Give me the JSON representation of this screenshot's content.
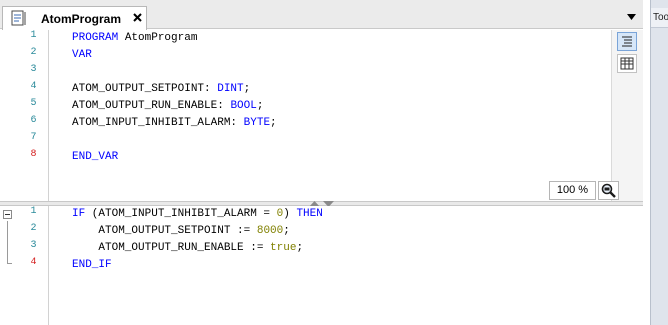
{
  "tab": {
    "label": "AtomProgram"
  },
  "right_panel": {
    "label": "Too"
  },
  "declaration": {
    "lines": [
      {
        "num": "1",
        "parts": [
          {
            "t": "PROGRAM",
            "c": "kw"
          },
          {
            "t": " AtomProgram",
            "c": ""
          }
        ]
      },
      {
        "num": "2",
        "parts": [
          {
            "t": "VAR",
            "c": "kw"
          }
        ]
      },
      {
        "num": "3",
        "parts": []
      },
      {
        "num": "4",
        "parts": [
          {
            "t": "ATOM_OUTPUT_SETPOINT: ",
            "c": ""
          },
          {
            "t": "DINT",
            "c": "kw"
          },
          {
            "t": ";",
            "c": ""
          }
        ]
      },
      {
        "num": "5",
        "parts": [
          {
            "t": "ATOM_OUTPUT_RUN_ENABLE: ",
            "c": ""
          },
          {
            "t": "BOOL",
            "c": "kw"
          },
          {
            "t": ";",
            "c": ""
          }
        ]
      },
      {
        "num": "6",
        "parts": [
          {
            "t": "ATOM_INPUT_INHIBIT_ALARM: ",
            "c": ""
          },
          {
            "t": "BYTE",
            "c": "kw"
          },
          {
            "t": ";",
            "c": ""
          }
        ]
      },
      {
        "num": "7",
        "parts": []
      },
      {
        "num": "8",
        "modified": true,
        "parts": [
          {
            "t": "END_VAR",
            "c": "kw"
          }
        ]
      }
    ]
  },
  "implementation": {
    "lines": [
      {
        "num": "1",
        "parts": [
          {
            "t": "IF",
            "c": "kw"
          },
          {
            "t": " (ATOM_INPUT_INHIBIT_ALARM = ",
            "c": ""
          },
          {
            "t": "0",
            "c": "num"
          },
          {
            "t": ") ",
            "c": ""
          },
          {
            "t": "THEN",
            "c": "kw"
          }
        ]
      },
      {
        "num": "2",
        "parts": [
          {
            "t": "    ATOM_OUTPUT_SETPOINT := ",
            "c": ""
          },
          {
            "t": "8000",
            "c": "num"
          },
          {
            "t": ";",
            "c": ""
          }
        ]
      },
      {
        "num": "3",
        "parts": [
          {
            "t": "    ATOM_OUTPUT_RUN_ENABLE := ",
            "c": ""
          },
          {
            "t": "true",
            "c": "num"
          },
          {
            "t": ";",
            "c": ""
          }
        ]
      },
      {
        "num": "4",
        "modified": true,
        "parts": [
          {
            "t": "END_IF",
            "c": "kw"
          }
        ]
      }
    ]
  },
  "zoom": "100 %",
  "colors": {
    "keyword": "#0000ff",
    "literal": "#808000",
    "line_number": "#2a8a9a",
    "modified_line_number": "#d42020"
  }
}
